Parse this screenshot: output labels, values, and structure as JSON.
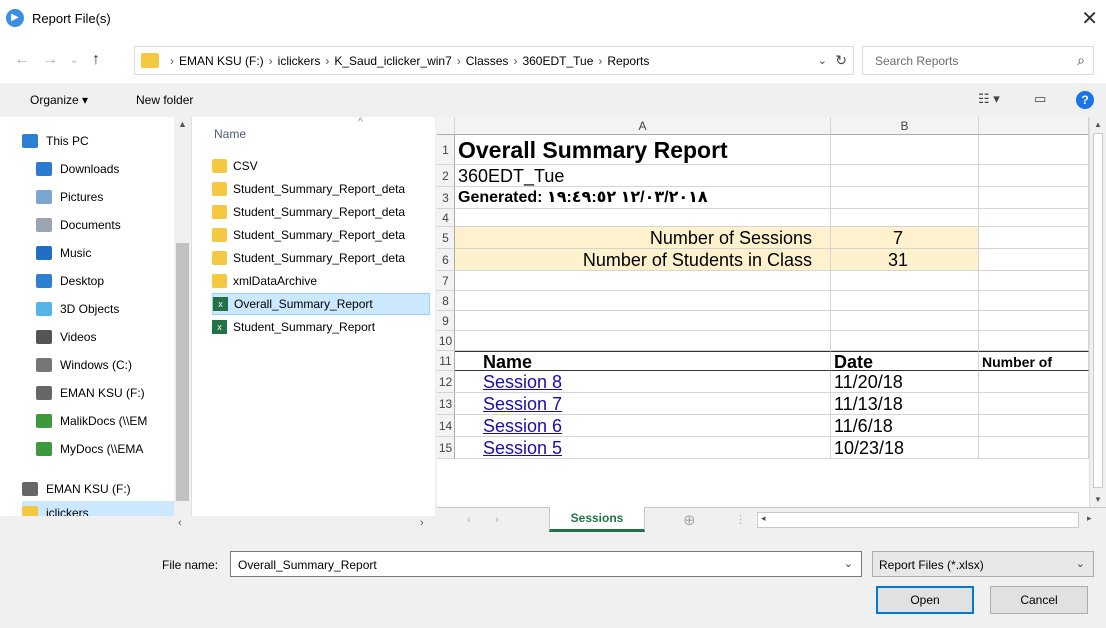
{
  "window": {
    "title": "Report File(s)"
  },
  "navigation": {
    "breadcrumbs": [
      "EMAN KSU (F:)",
      "iclickers",
      "K_Saud_iclicker_win7",
      "Classes",
      "360EDT_Tue",
      "Reports"
    ],
    "search_placeholder": "Search Reports"
  },
  "toolbar": {
    "organize": "Organize ▾",
    "new_folder": "New folder"
  },
  "sidebar": {
    "items": [
      {
        "label": "This PC",
        "icon": "pc-icon",
        "color": "#2f7fd1"
      },
      {
        "label": "Downloads",
        "icon": "downloads-icon",
        "color": "#2a7bd3"
      },
      {
        "label": "Pictures",
        "icon": "pictures-icon",
        "color": "#7aa6cf"
      },
      {
        "label": "Documents",
        "icon": "documents-icon",
        "color": "#9aa5b1"
      },
      {
        "label": "Music",
        "icon": "music-icon",
        "color": "#1f6fc5"
      },
      {
        "label": "Desktop",
        "icon": "desktop-icon",
        "color": "#2f7fd1"
      },
      {
        "label": "3D Objects",
        "icon": "3d-objects-icon",
        "color": "#55b4e6"
      },
      {
        "label": "Videos",
        "icon": "videos-icon",
        "color": "#555"
      },
      {
        "label": "Windows (C:)",
        "icon": "drive-icon",
        "color": "#777"
      },
      {
        "label": "EMAN KSU (F:)",
        "icon": "drive-icon",
        "color": "#666"
      },
      {
        "label": "MalikDocs (\\\\EM",
        "icon": "network-drive-icon",
        "color": "#3c9a3c"
      },
      {
        "label": "MyDocs (\\\\EMA",
        "icon": "network-drive-icon",
        "color": "#3c9a3c"
      },
      {
        "label": "EMAN KSU (F:)",
        "icon": "drive-icon",
        "color": "#666"
      },
      {
        "label": "iclickers",
        "icon": "folder-icon",
        "color": "#f5c842"
      }
    ]
  },
  "files": {
    "column_header": "Name",
    "items": [
      {
        "label": "CSV",
        "icon": "folder-icon"
      },
      {
        "label": "Student_Summary_Report_deta",
        "icon": "folder-icon"
      },
      {
        "label": "Student_Summary_Report_deta",
        "icon": "folder-icon"
      },
      {
        "label": "Student_Summary_Report_deta",
        "icon": "folder-icon"
      },
      {
        "label": "Student_Summary_Report_deta",
        "icon": "folder-icon"
      },
      {
        "label": "xmlDataArchive",
        "icon": "folder-icon"
      },
      {
        "label": "Overall_Summary_Report",
        "icon": "excel-file-icon",
        "selected": true
      },
      {
        "label": "Student_Summary_Report",
        "icon": "excel-file-icon"
      }
    ]
  },
  "preview": {
    "columns": [
      "A",
      "B"
    ],
    "rows": [
      {
        "num": "1",
        "a": "Overall Summary Report",
        "b": "",
        "c": ""
      },
      {
        "num": "2",
        "a": "360EDT_Tue",
        "b": "",
        "c": ""
      },
      {
        "num": "3",
        "a": "Generated: ١٢/٠٣/٢٠١٨ ١٩:٤٩:٥٢",
        "b": "",
        "c": ""
      },
      {
        "num": "4",
        "a": "",
        "b": "",
        "c": ""
      },
      {
        "num": "5",
        "a": "Number of Sessions",
        "b": "7",
        "c": ""
      },
      {
        "num": "6",
        "a": "Number of Students in Class",
        "b": "31",
        "c": ""
      },
      {
        "num": "7",
        "a": "",
        "b": "",
        "c": ""
      },
      {
        "num": "8",
        "a": "",
        "b": "",
        "c": ""
      },
      {
        "num": "9",
        "a": "",
        "b": "",
        "c": ""
      },
      {
        "num": "10",
        "a": "",
        "b": "",
        "c": ""
      },
      {
        "num": "11",
        "a": "Name",
        "b": "Date",
        "c": "Number of"
      },
      {
        "num": "12",
        "a": "Session 8",
        "b": "11/20/18",
        "c": ""
      },
      {
        "num": "13",
        "a": "Session 7",
        "b": "11/13/18",
        "c": ""
      },
      {
        "num": "14",
        "a": "Session 6",
        "b": "11/6/18",
        "c": ""
      },
      {
        "num": "15",
        "a": "Session 5",
        "b": "10/23/18",
        "c": ""
      }
    ],
    "sheet_tab": "Sessions",
    "add_sheet": "⊕"
  },
  "footer": {
    "filename_label": "File name:",
    "filename_value": "Overall_Summary_Report",
    "filter_value": "Report Files (*.xlsx)",
    "open_label": "Open",
    "cancel_label": "Cancel"
  },
  "colors": {
    "selection": "#cce8ff",
    "excel_green": "#217346",
    "link": "#1a0dab",
    "summary_fill": "#fdf2cd"
  }
}
